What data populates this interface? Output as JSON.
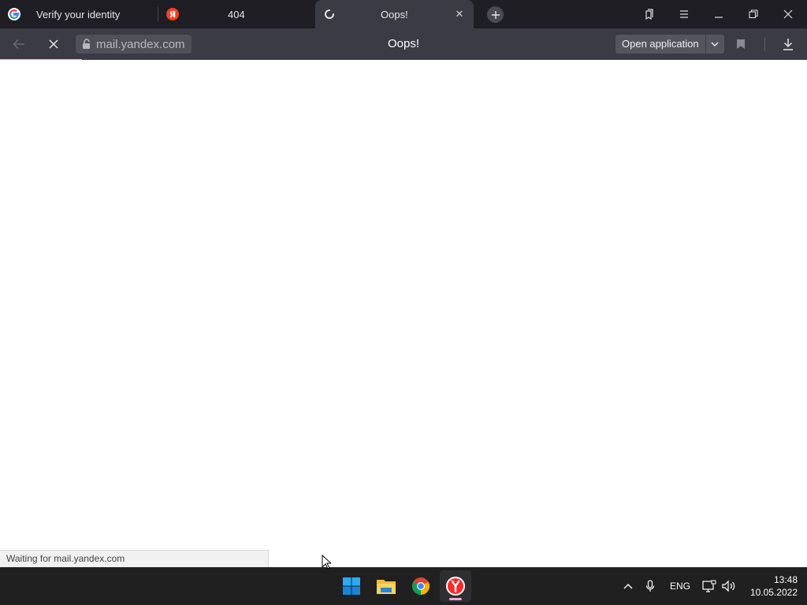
{
  "tabs": [
    {
      "title": "Verify your identity",
      "icon": "google-icon"
    },
    {
      "title": "404",
      "icon": "yandex-icon"
    },
    {
      "title": "Oops!",
      "icon": "loading-spinner-icon",
      "active": true
    }
  ],
  "toolbar": {
    "url": "mail.yandex.com",
    "page_title": "Oops!",
    "open_app_label": "Open application"
  },
  "page": {
    "status_text": "Waiting for mail.yandex.com"
  },
  "taskbar": {
    "apps": [
      "windows-start-icon",
      "file-explorer-icon",
      "chrome-icon",
      "yandex-browser-icon"
    ],
    "language": "ENG",
    "time": "13:48",
    "date": "10.05.2022"
  },
  "colors": {
    "tabstrip_bg": "#1e1e24",
    "toolbar_bg": "#3b3b45",
    "progress": "#f5c518",
    "taskbar_bg": "#202020"
  }
}
